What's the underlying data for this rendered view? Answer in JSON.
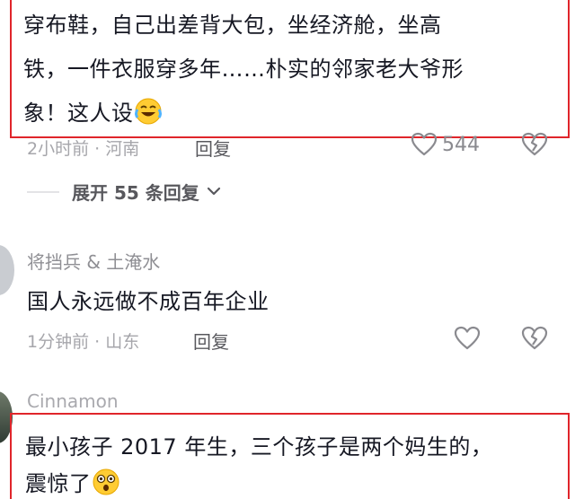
{
  "comments": [
    {
      "text_line1": "穿布鞋，自己出差背大包，坐经济舱，坐高",
      "text_line2": "铁，一件衣服穿多年……朴实的邻家老大爷形",
      "text_line3": "象！这人设",
      "emoji": "laughing-crying-emoji",
      "meta": "2小时前 · 河南",
      "reply_label": "回复",
      "like_count": "544",
      "expand_label": "展开 55 条回复"
    },
    {
      "username": "将挡兵 & 土淹水",
      "text": "国人永远做不成百年企业",
      "meta": "1分钟前 · 山东",
      "reply_label": "回复"
    },
    {
      "username": "Cinnamon",
      "text_line1": "最小孩子 2017 年生，三个孩子是两个妈生的，",
      "text_line2": "震惊了",
      "emoji": "astonished-emoji"
    }
  ],
  "colors": {
    "highlight": "#e0252b",
    "text": "#161823",
    "meta": "#a6a6ab"
  }
}
